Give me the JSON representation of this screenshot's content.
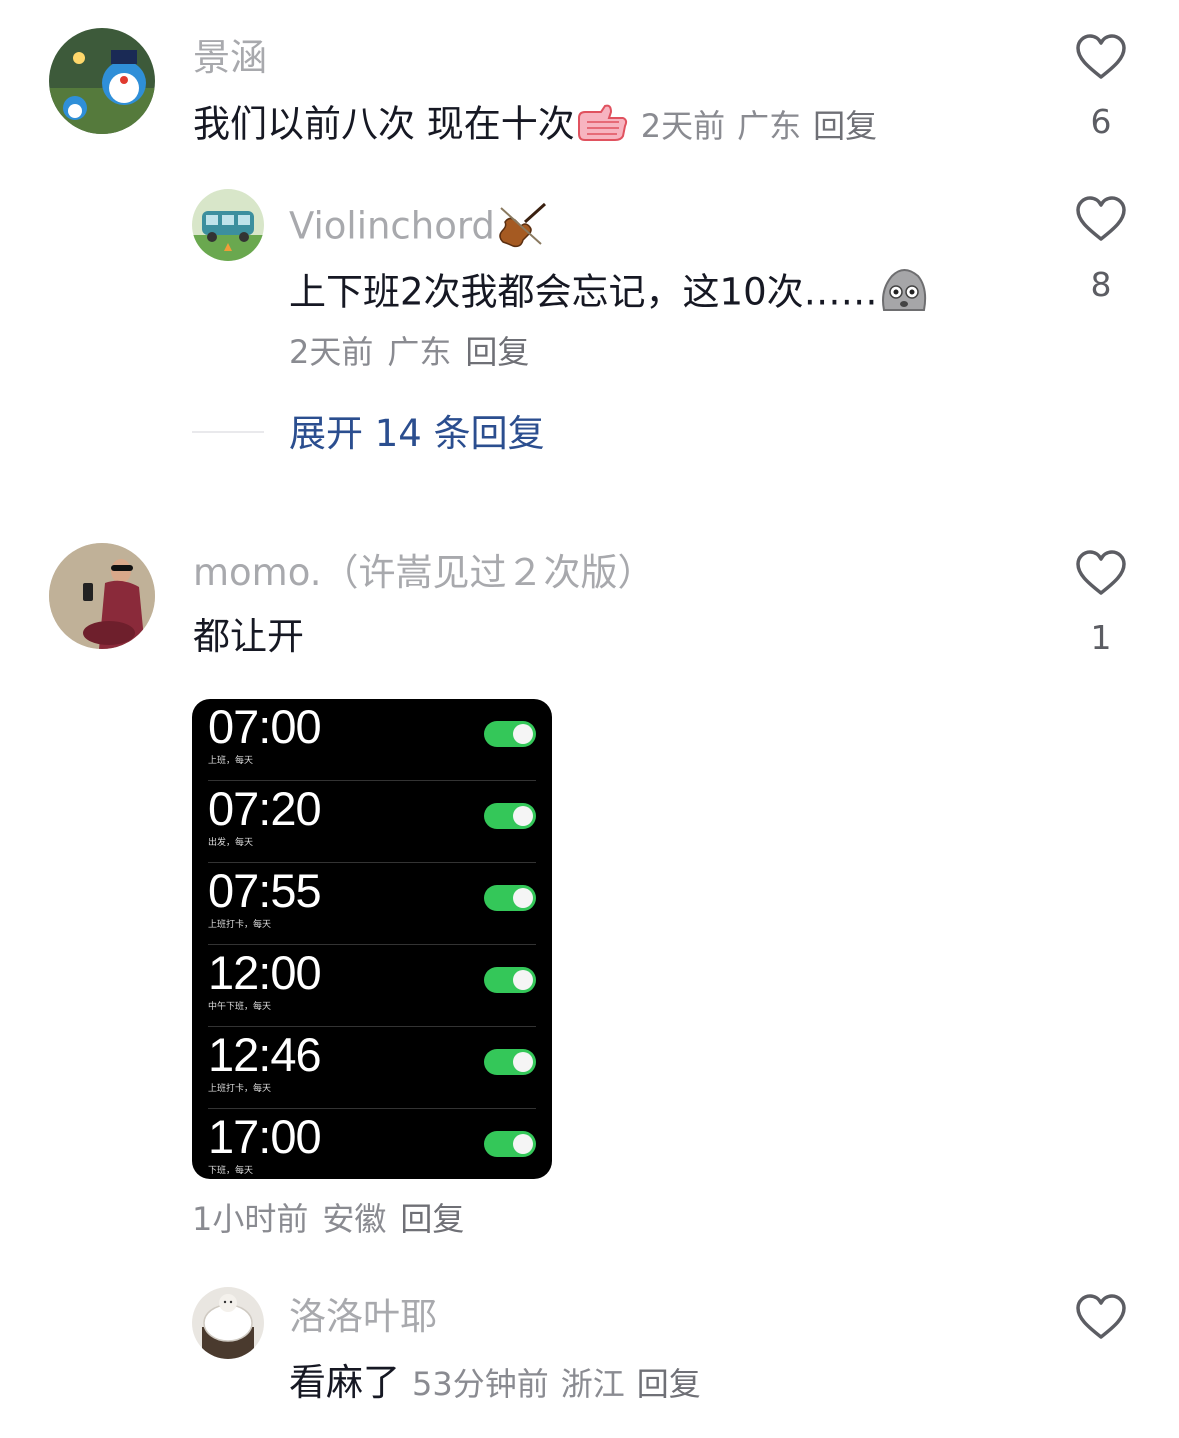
{
  "comments": [
    {
      "username": "景涵",
      "text": "我们以前八次 现在十次",
      "emoji_icon": "thumbs-up-emoji-icon",
      "time": "2天前",
      "location": "广东",
      "reply_label": "回复",
      "likes": "6",
      "replies": [
        {
          "username": "Violinchord",
          "username_emoji_icon": "violin-emoji-icon",
          "text": "上下班2次我都会忘记，这10次……",
          "emoji_icon": "shocked-face-emoji-icon",
          "time": "2天前",
          "location": "广东",
          "reply_label": "回复",
          "likes": "8"
        }
      ],
      "expand_label": "展开 14 条回复"
    },
    {
      "username": "momo.（许嵩见过２次版）",
      "text": "都让开",
      "time": "1小时前",
      "location": "安徽",
      "reply_label": "回复",
      "likes": "1",
      "attachment": {
        "type": "alarm-screenshot",
        "alarms": [
          {
            "time": "07:00",
            "label": "上班，每天",
            "enabled": true
          },
          {
            "time": "07:20",
            "label": "出发，每天",
            "enabled": true
          },
          {
            "time": "07:55",
            "label": "上班打卡，每天",
            "enabled": true
          },
          {
            "time": "12:00",
            "label": "中午下班，每天",
            "enabled": true
          },
          {
            "time": "12:46",
            "label": "上班打卡，每天",
            "enabled": true
          },
          {
            "time": "17:00",
            "label": "下班，每天",
            "enabled": true
          }
        ]
      },
      "replies": [
        {
          "username": "洛洛叶耶",
          "text": "看麻了",
          "time": "53分钟前",
          "location": "浙江",
          "reply_label": "回复"
        }
      ]
    }
  ],
  "colors": {
    "username": "#a8a9ad",
    "meta": "#8a8b91",
    "expand": "#2b4e8f",
    "toggle_on": "#34c759"
  }
}
